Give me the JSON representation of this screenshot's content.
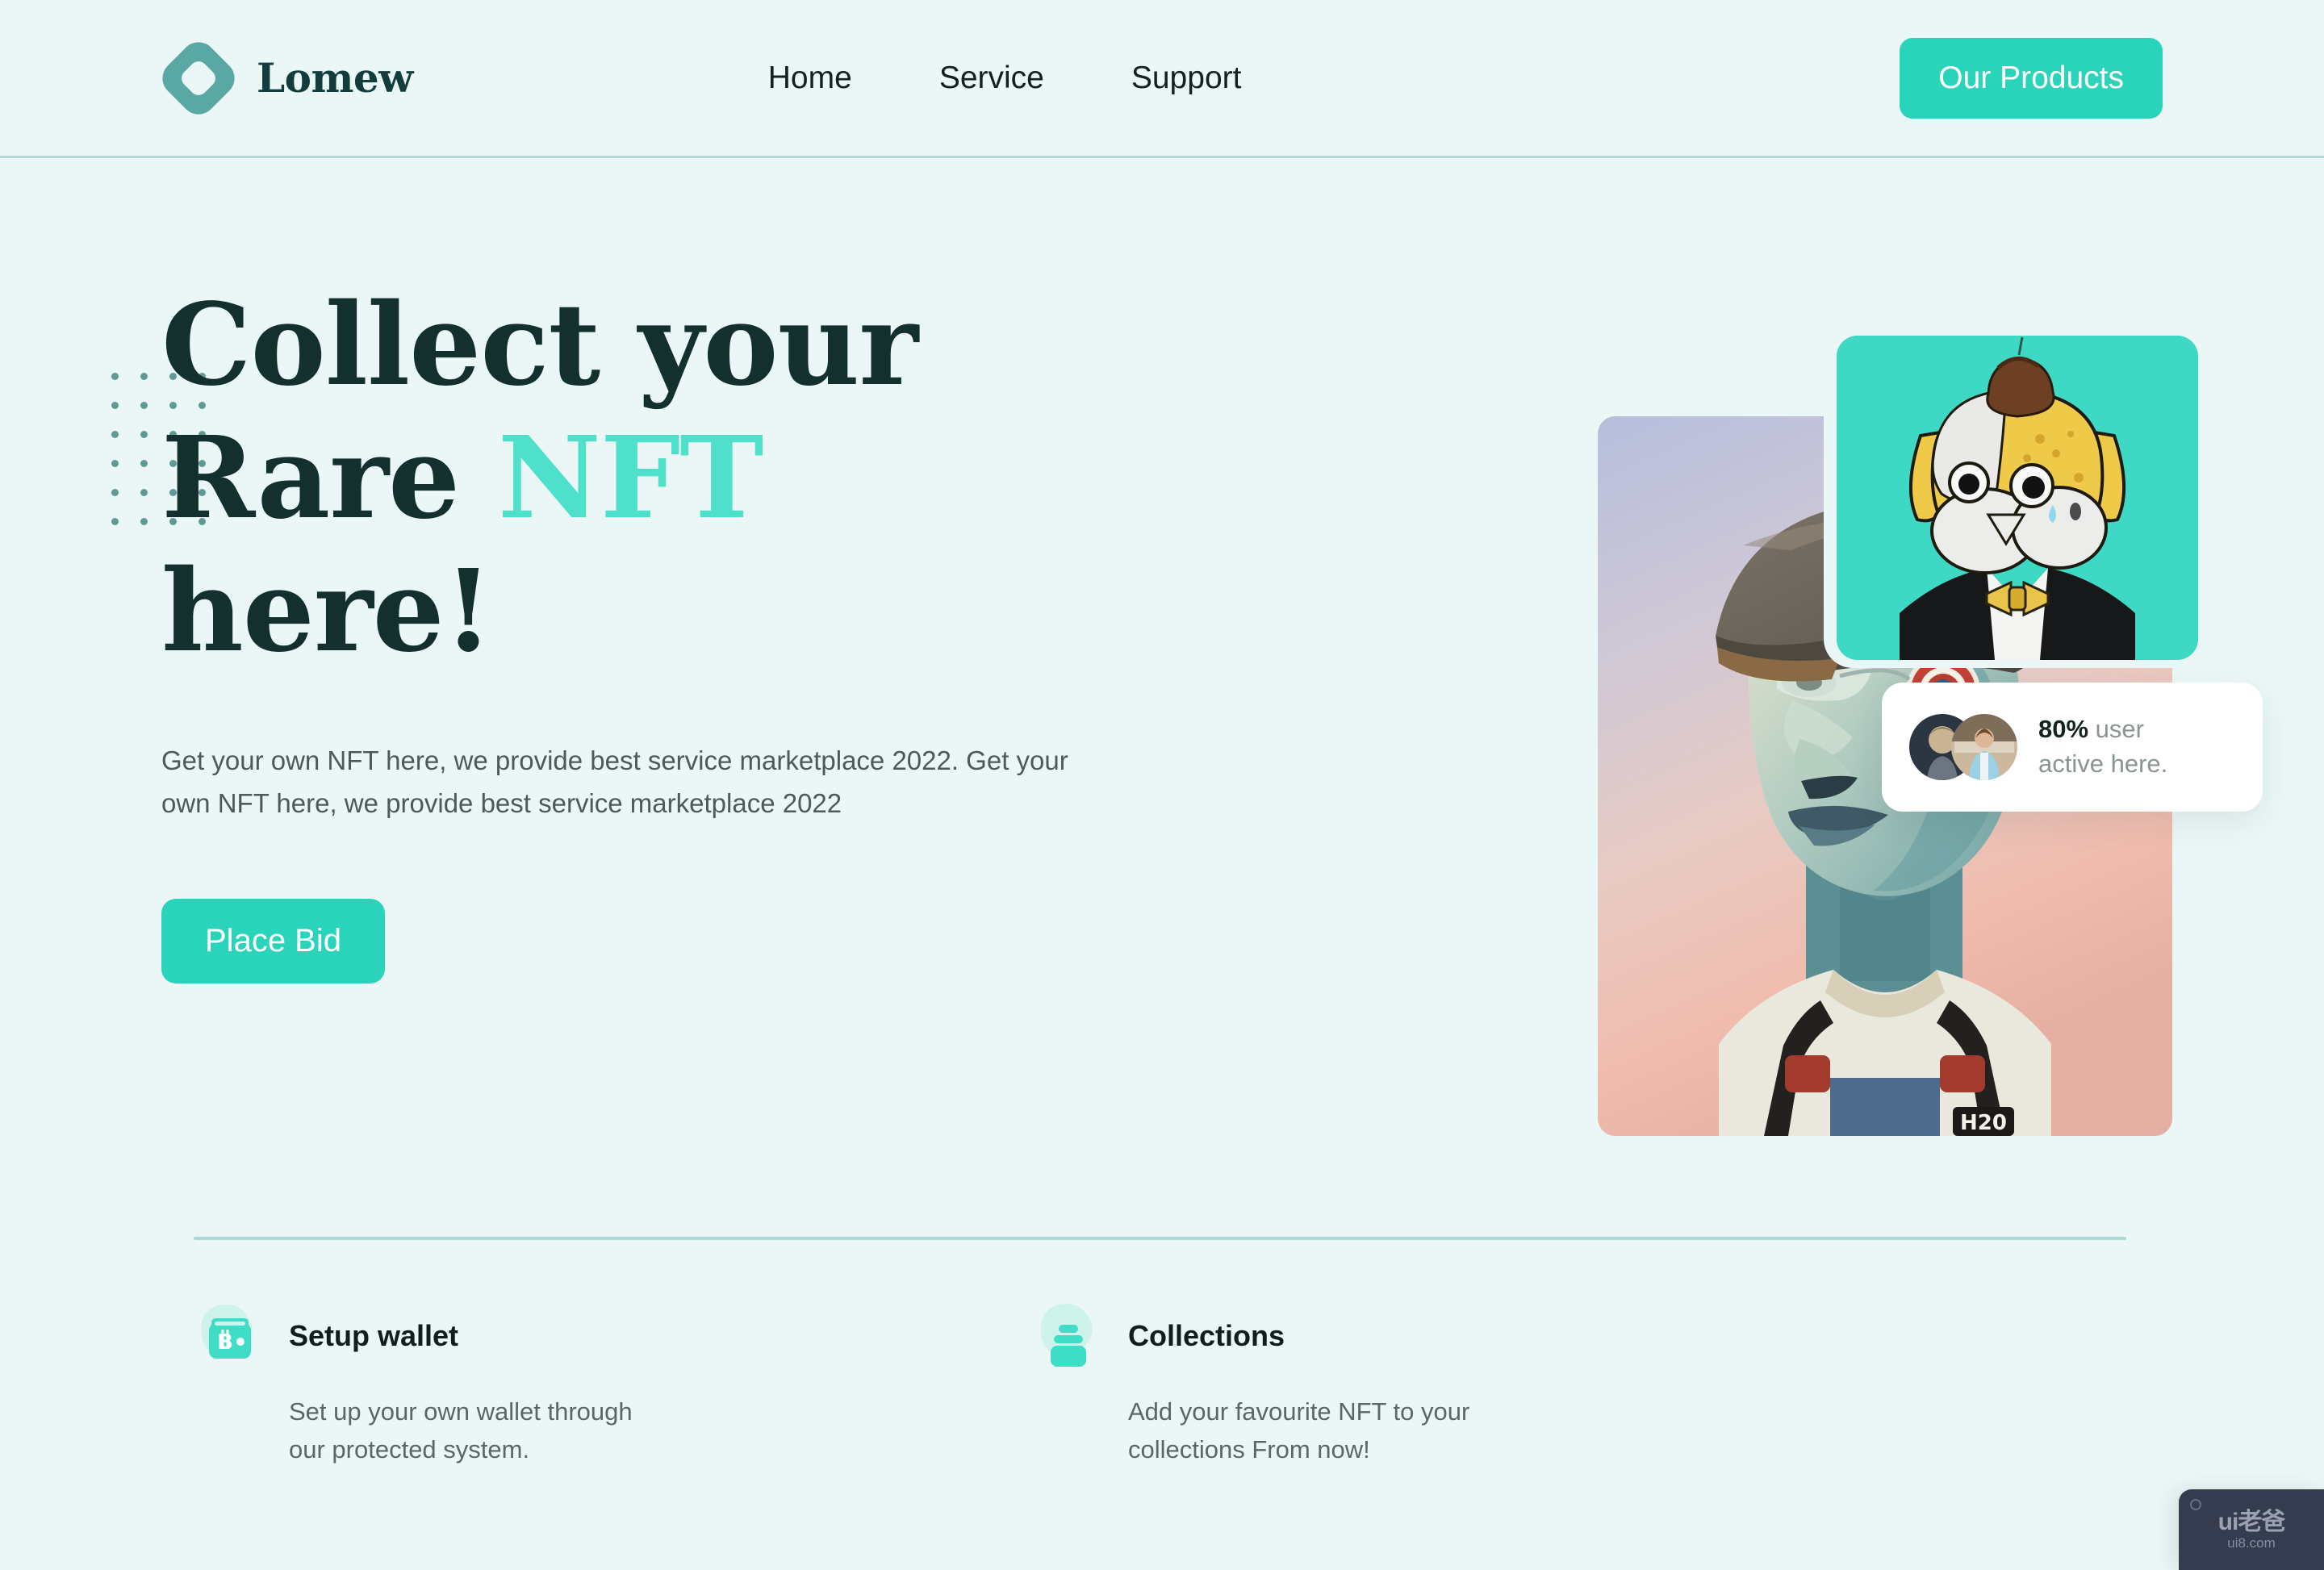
{
  "brand": {
    "name": "Lomew",
    "logo_color": "#5aa8a4",
    "text_color": "#123d3c"
  },
  "header": {
    "nav": [
      {
        "label": "Home"
      },
      {
        "label": "Service"
      },
      {
        "label": "Support"
      }
    ],
    "cta": {
      "label": "Our Products",
      "bg": "#2ad4bb",
      "fg": "#ffffff"
    }
  },
  "hero": {
    "title_line1": "Collect your",
    "title_line2_plain": "Rare ",
    "title_line2_accent": "NFT",
    "title_line3": "here!",
    "accent_color": "#4fe0cc",
    "subtitle": "Get your own NFT here, we provide best service marketplace 2022. Get your own NFT here, we provide best service marketplace 2022",
    "cta": {
      "label": "Place Bid",
      "bg": "#2ad4bb",
      "fg": "#ffffff"
    },
    "stat_card": {
      "percent": "80%",
      "text_line1": " user",
      "text_line2": "active here."
    },
    "small_card_bg": "#3ed9c4"
  },
  "features": [
    {
      "icon": "wallet-bitcoin-icon",
      "title": "Setup wallet",
      "description": "Set up your own wallet through our protected system."
    },
    {
      "icon": "stacked-layers-icon",
      "title": "Collections",
      "description": "Add your favourite NFT to your collections From now!"
    }
  ],
  "watermark": {
    "main": "ui老爸",
    "sub": "ui8.com"
  },
  "theme": {
    "page_bg": "#eaf7f6",
    "divider": "#aed6d2",
    "body_text": "#4e5a58",
    "heading_text": "#14302e"
  }
}
